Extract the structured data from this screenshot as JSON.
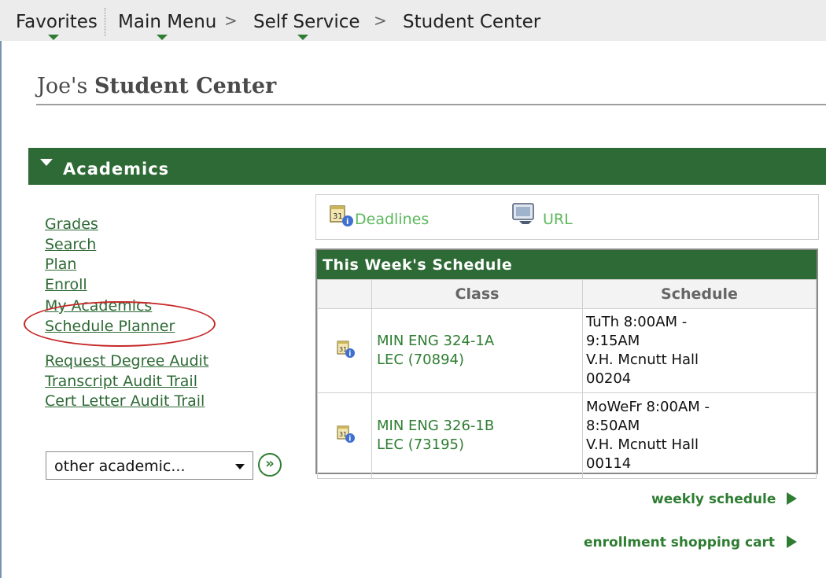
{
  "nav": {
    "favorites": "Favorites",
    "main_menu": "Main Menu",
    "self_service": "Self Service",
    "student_center": "Student Center",
    "separator": ">"
  },
  "page": {
    "title_owner": "Joe's",
    "title_main": "Student Center"
  },
  "academics": {
    "header": "Academics",
    "links": [
      "Grades",
      "Search",
      "Plan",
      "Enroll",
      "My Academics",
      "Schedule Planner",
      "Request Degree Audit",
      "Transcript Audit Trail",
      "Cert Letter Audit Trail"
    ],
    "dropdown_value": "other academic...",
    "go_label": "»"
  },
  "toolbar": {
    "deadlines": "Deadlines",
    "url": "URL"
  },
  "schedule": {
    "title": "This Week's Schedule",
    "columns": [
      "Class",
      "Schedule"
    ],
    "rows": [
      {
        "class_line1": "MIN ENG 324-1A",
        "class_line2": "LEC (70894)",
        "sched_line1": "TuTh 8:00AM -",
        "sched_line2": "9:15AM",
        "sched_line3": "V.H. Mcnutt Hall",
        "sched_line4": "00204"
      },
      {
        "class_line1": "MIN ENG 326-1B",
        "class_line2": "LEC (73195)",
        "sched_line1": "MoWeFr 8:00AM -",
        "sched_line2": "8:50AM",
        "sched_line3": "V.H. Mcnutt Hall",
        "sched_line4": "00114"
      }
    ],
    "weekly_link": "weekly schedule",
    "cart_link": "enrollment shopping cart"
  },
  "colors": {
    "header_green": "#2e6a35",
    "link_green": "#2e7d32",
    "highlight_oval": "#c62828"
  }
}
